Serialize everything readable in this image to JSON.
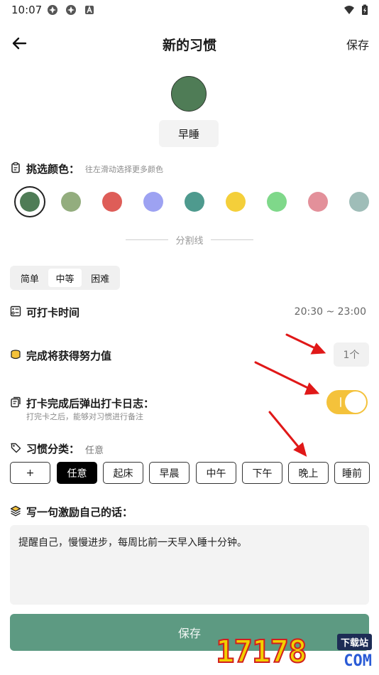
{
  "status_bar": {
    "time": "10:07"
  },
  "header": {
    "title": "新的习惯",
    "save_label": "保存"
  },
  "habit": {
    "name": "早睡",
    "color": "#4f7c56"
  },
  "color_section": {
    "label": "挑选颜色：",
    "hint": "往左滑动选择更多颜色",
    "colors": [
      "#4f7c56",
      "#93ad7e",
      "#de5d58",
      "#9da2f2",
      "#4e9a8e",
      "#f4cf3a",
      "#7fd88a",
      "#e3909a",
      "#9fbdb8"
    ],
    "selected_index": 0
  },
  "divider": {
    "label": "分割线"
  },
  "difficulty": {
    "options": [
      "简单",
      "中等",
      "困难"
    ],
    "selected_index": 1
  },
  "checkin_time": {
    "label": "可打卡时间",
    "value": "20:30 ~ 23:00"
  },
  "points": {
    "label": "完成将获得努力值",
    "value": "1个"
  },
  "log_popup": {
    "label": "打卡完成后弹出打卡日志：",
    "hint": "打完卡之后，能够对习惯进行备注",
    "enabled": true
  },
  "category": {
    "label": "习惯分类：",
    "current": "任意",
    "chips": [
      "+",
      "任意",
      "起床",
      "早晨",
      "中午",
      "下午",
      "晚上",
      "睡前"
    ],
    "selected_index": 1
  },
  "motto": {
    "label": "写一句激励自己的话：",
    "value": "提醒自己，慢慢进步，每周比前一天早入睡十分钟。"
  },
  "footer": {
    "save_label": "保存"
  },
  "watermark": {
    "number": "17178",
    "tag": "下载站",
    "domain": "COM"
  },
  "accent_colors": {
    "save_button": "#5d9a82",
    "toggle": "#f4c23b",
    "annotation_arrow": "#e01818"
  }
}
